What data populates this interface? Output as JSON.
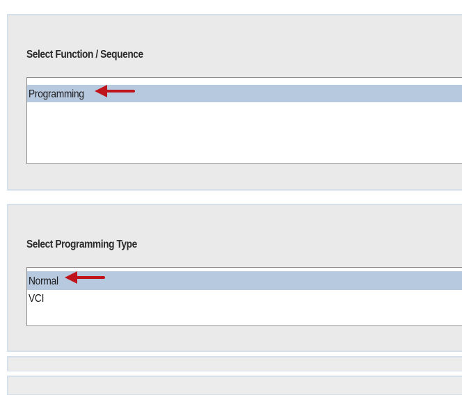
{
  "function_panel": {
    "label": "Select Function / Sequence",
    "items": [
      {
        "label": "Programming",
        "selected": true
      }
    ]
  },
  "programming_type_panel": {
    "label": "Select Programming Type",
    "items": [
      {
        "label": "Normal",
        "selected": true
      },
      {
        "label": "VCI",
        "selected": false
      }
    ]
  },
  "colors": {
    "panel_background": "#eaeaea",
    "panel_border": "#d6e0ea",
    "selection_highlight": "#b7c9df",
    "annotation_arrow": "#c0141c"
  },
  "icons": {
    "annotation": "red-arrow-left-icon"
  }
}
